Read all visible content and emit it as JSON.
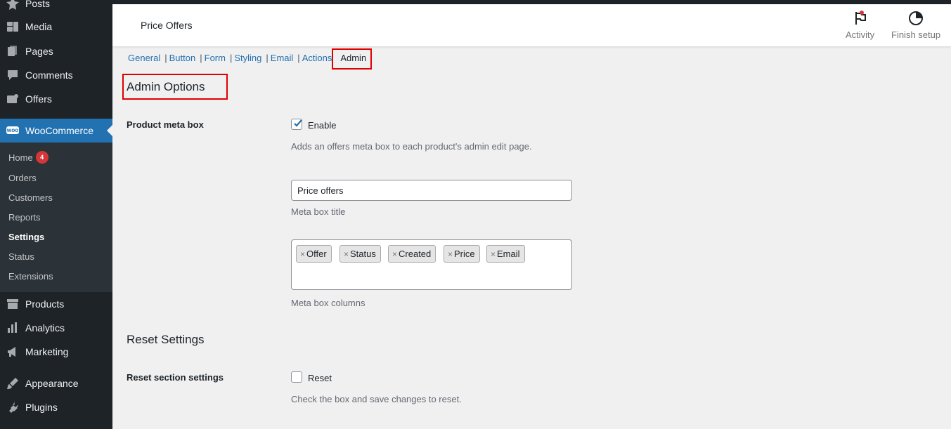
{
  "sidebar": {
    "items": [
      {
        "label": "Posts",
        "icon": "pin-icon"
      },
      {
        "label": "Media",
        "icon": "media-icon"
      },
      {
        "label": "Pages",
        "icon": "pages-icon"
      },
      {
        "label": "Comments",
        "icon": "comment-icon"
      },
      {
        "label": "Offers",
        "icon": "offers-icon"
      },
      {
        "label": "WooCommerce",
        "icon": "woo-icon"
      },
      {
        "label": "Products",
        "icon": "archive-icon"
      },
      {
        "label": "Analytics",
        "icon": "chart-icon"
      },
      {
        "label": "Marketing",
        "icon": "megaphone-icon"
      },
      {
        "label": "Appearance",
        "icon": "brush-icon"
      },
      {
        "label": "Plugins",
        "icon": "plug-icon"
      }
    ],
    "submenu": [
      {
        "label": "Home",
        "badge": "4"
      },
      {
        "label": "Orders"
      },
      {
        "label": "Customers"
      },
      {
        "label": "Reports"
      },
      {
        "label": "Settings"
      },
      {
        "label": "Status"
      },
      {
        "label": "Extensions"
      }
    ]
  },
  "header": {
    "title": "Price Offers",
    "activity_label": "Activity",
    "finish_setup_label": "Finish setup"
  },
  "tabs": [
    "General",
    "Button",
    "Form",
    "Styling",
    "Email",
    "Actions",
    "Admin"
  ],
  "admin_options": {
    "heading": "Admin Options",
    "product_meta_box": {
      "label": "Product meta box",
      "checkbox_label": "Enable",
      "checked": true,
      "description": "Adds an offers meta box to each product's admin edit page."
    },
    "meta_box_title": {
      "value": "Price offers",
      "description": "Meta box title"
    },
    "meta_box_columns": {
      "chips": [
        "Offer",
        "Status",
        "Created",
        "Price",
        "Email"
      ],
      "description": "Meta box columns"
    }
  },
  "reset_settings": {
    "heading": "Reset Settings",
    "label": "Reset section settings",
    "checkbox_label": "Reset",
    "checked": false,
    "description": "Check the box and save changes to reset."
  },
  "colors": {
    "sidebar_bg": "#1d2327",
    "accent": "#2271b1",
    "highlight": "#e00000",
    "badge": "#d63638"
  }
}
